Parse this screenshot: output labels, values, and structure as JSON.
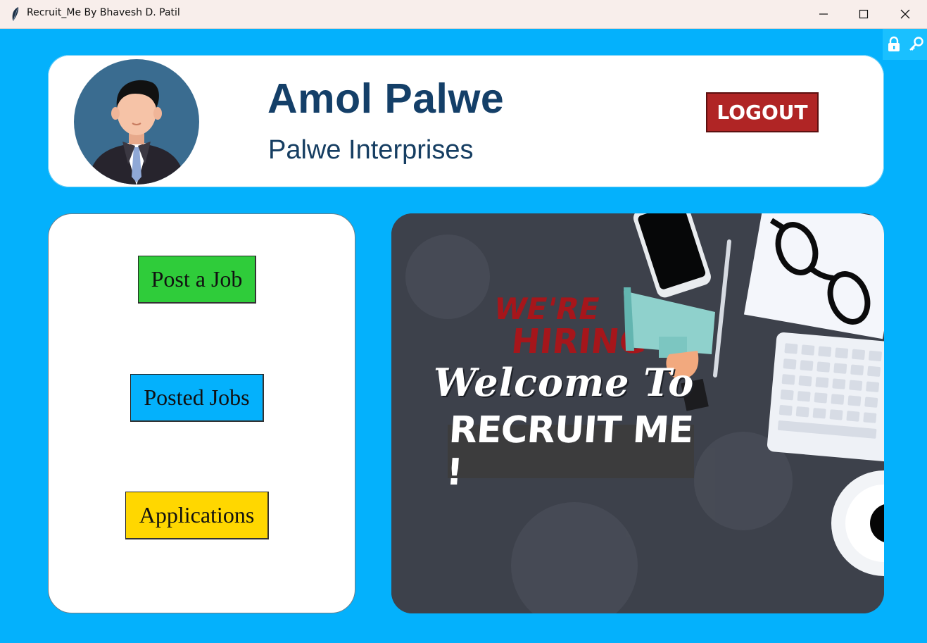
{
  "window": {
    "title": "Recruit_Me By Bhavesh D. Patil",
    "minimize_icon": "minimize-icon",
    "maximize_icon": "maximize-icon",
    "close_icon": "close-icon"
  },
  "header": {
    "user_name": "Amol Palwe",
    "company": "Palwe Interprises",
    "logout_label": "LOGOUT",
    "avatar_icon": "businessman-avatar-icon"
  },
  "menu": {
    "post_job": "Post a Job",
    "posted_jobs": "Posted Jobs",
    "applications": "Applications"
  },
  "banner": {
    "hiring_line1": "WE'RE",
    "hiring_line2": "HIRING",
    "welcome": "Welcome To",
    "app_name": "RECRUIT ME !"
  },
  "tray": {
    "icons": [
      "lock-icon",
      "key-icon"
    ]
  },
  "colors": {
    "background": "#04B1FC",
    "name": "#143F68",
    "logout": "#B02525",
    "post_job": "#2FCC3A",
    "posted_jobs": "#04B1FC",
    "applications": "#FFD700"
  }
}
